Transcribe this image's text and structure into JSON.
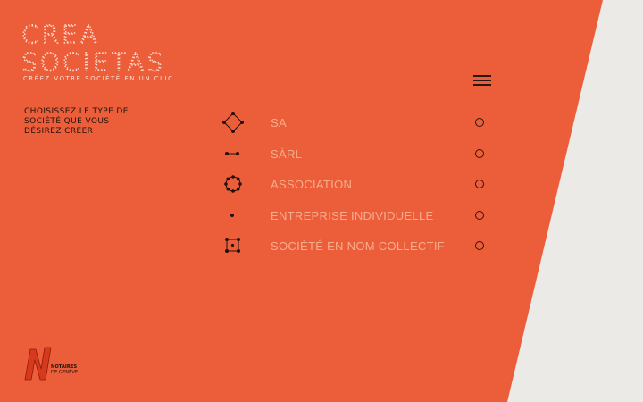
{
  "logo": {
    "line1": "CREA",
    "line2": "SOCIETAS",
    "tagline": "CRÉEZ VOTRE SOCIÉTÉ EN UN CLIC"
  },
  "menu": {
    "icon": "hamburger-menu-icon"
  },
  "instruction": "CHOISISSEZ LE TYPE DE\nSOCIÉTÉ QUE VOUS\nDÉSIREZ CRÉER",
  "options": [
    {
      "label": "SA",
      "icon": "diamond-nodes-icon",
      "selected": false
    },
    {
      "label": "SÀRL",
      "icon": "two-dots-line-icon",
      "selected": false
    },
    {
      "label": "ASSOCIATION",
      "icon": "circle-of-dots-icon",
      "selected": false
    },
    {
      "label": "ENTREPRISE INDIVIDUELLE",
      "icon": "single-dot-icon",
      "selected": false
    },
    {
      "label": "SOCIÉTÉ EN NOM COLLECTIF",
      "icon": "square-nodes-icon",
      "selected": false
    }
  ],
  "footer": {
    "line1": "NOTAIRES",
    "line2": "DE GENÈVE"
  },
  "colors": {
    "orange": "#ec5e3a",
    "background": "#ebeae6",
    "dark": "#1f120d",
    "option_text": "#f6ad8e",
    "logo": "#fde0d5"
  }
}
